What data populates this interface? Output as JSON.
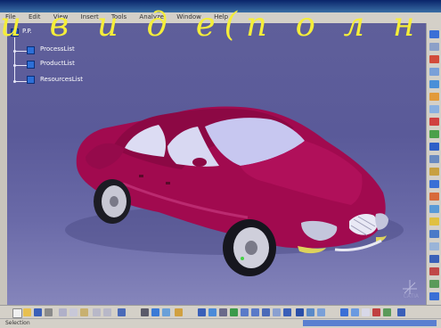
{
  "overlay": {
    "title_text": "и в и д е(п о л н ы"
  },
  "menu": {
    "items": [
      "File",
      "Edit",
      "View",
      "Insert",
      "Tools",
      "Analyze",
      "Window",
      "Help"
    ]
  },
  "tree": {
    "root": "P.P.",
    "items": [
      {
        "label": "ProcessList"
      },
      {
        "label": "ProductList"
      },
      {
        "label": "ResourcesList"
      }
    ]
  },
  "statusbar": {
    "text": "Selection"
  },
  "watermark": {
    "text": "CATIA"
  },
  "colors": {
    "viewport_bg": "#5f5f9a",
    "car_body": "#a10a4f",
    "overlay_text": "#f5ee3a",
    "tree_icon": "#2d6fd6"
  },
  "icons": {
    "tree_root": "product-tree-icon",
    "tree_item": "list-node-icon",
    "car": "car-3d-model",
    "compass": "compass-icon"
  }
}
